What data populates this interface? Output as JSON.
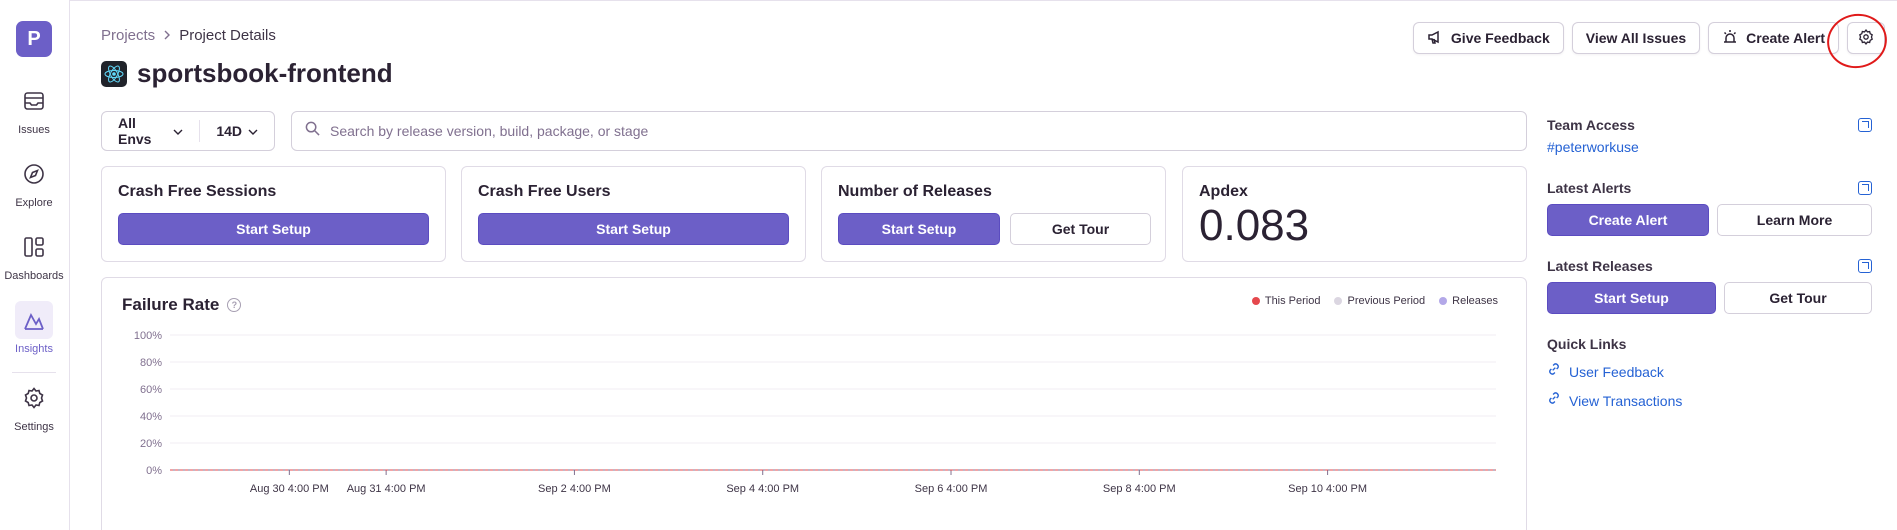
{
  "sidebar": {
    "org_initial": "P",
    "items": [
      {
        "label": "Issues",
        "icon": "issues-icon"
      },
      {
        "label": "Explore",
        "icon": "compass-icon"
      },
      {
        "label": "Dashboards",
        "icon": "dashboards-icon"
      },
      {
        "label": "Insights",
        "icon": "insights-icon",
        "active": true
      },
      {
        "label": "Settings",
        "icon": "gear-icon"
      }
    ]
  },
  "breadcrumb": {
    "root": "Projects",
    "current": "Project Details"
  },
  "project": {
    "name": "sportsbook-frontend",
    "platform_icon": "react-icon"
  },
  "header_actions": {
    "give_feedback": "Give Feedback",
    "view_all_issues": "View All Issues",
    "create_alert": "Create Alert",
    "settings_icon": "gear-icon"
  },
  "filters": {
    "environment": "All Envs",
    "period": "14D",
    "search_placeholder": "Search by release version, build, package, or stage"
  },
  "score_cards": {
    "crash_free_sessions": {
      "title": "Crash Free Sessions",
      "button": "Start Setup"
    },
    "crash_free_users": {
      "title": "Crash Free Users",
      "button": "Start Setup"
    },
    "number_of_releases": {
      "title": "Number of Releases",
      "button": "Start Setup",
      "secondary_button": "Get Tour"
    },
    "apdex": {
      "title": "Apdex",
      "value": "0.083"
    }
  },
  "chart": {
    "title": "Failure Rate",
    "legend": [
      "This Period",
      "Previous Period",
      "Releases"
    ]
  },
  "chart_data": {
    "type": "line",
    "title": "Failure Rate",
    "y_ticks": [
      "100%",
      "80%",
      "60%",
      "40%",
      "20%",
      "0%"
    ],
    "x_ticks": [
      "Aug 30 4:00 PM",
      "Aug 31 4:00 PM",
      "Sep 2 4:00 PM",
      "Sep 4 4:00 PM",
      "Sep 6 4:00 PM",
      "Sep 8 4:00 PM",
      "Sep 10 4:00 PM"
    ],
    "ylim": [
      0,
      100
    ],
    "series": [
      {
        "name": "This Period",
        "color": "#e5484d",
        "values": [
          0,
          0,
          0,
          0,
          0,
          0,
          0
        ]
      }
    ],
    "legend_position": "top-right"
  },
  "sidebar_right": {
    "team_access": {
      "heading": "Team Access",
      "team": "#peterworkuse"
    },
    "latest_alerts": {
      "heading": "Latest Alerts",
      "primary": "Create Alert",
      "secondary": "Learn More"
    },
    "latest_releases": {
      "heading": "Latest Releases",
      "primary": "Start Setup",
      "secondary": "Get Tour"
    },
    "quick_links": {
      "heading": "Quick Links",
      "links": [
        "User Feedback",
        "View Transactions"
      ]
    }
  },
  "colors": {
    "accent": "#6c5fc7",
    "link": "#2562d4",
    "annotation": "#e01a1a"
  }
}
